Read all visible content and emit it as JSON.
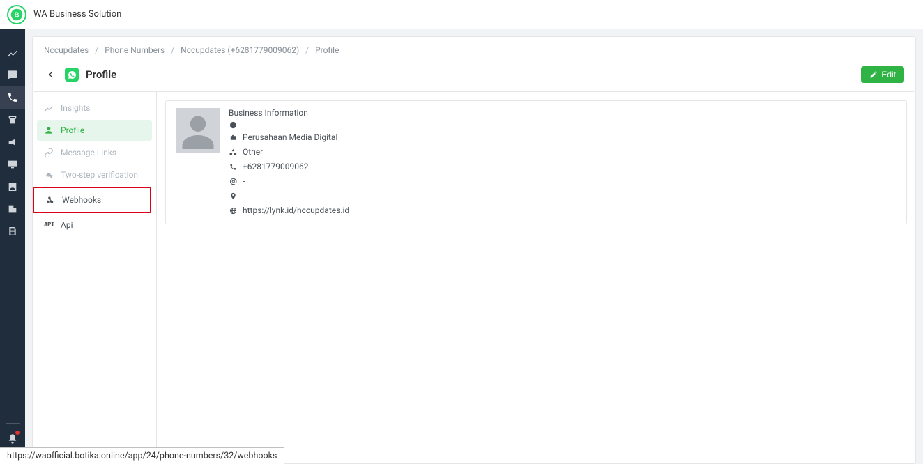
{
  "app": {
    "title": "WA Business Solution"
  },
  "breadcrumbs": {
    "items": [
      "Nccupdates",
      "Phone Numbers",
      "Nccupdates (+6281779009062)",
      "Profile"
    ]
  },
  "page": {
    "title": "Profile",
    "edit_label": "Edit"
  },
  "subnav": {
    "insights": "Insights",
    "profile": "Profile",
    "message_links": "Message Links",
    "two_step": "Two-step verification",
    "webhooks": "Webhooks",
    "api": "Api"
  },
  "business": {
    "heading": "Business Information",
    "company": "Perusahaan Media Digital",
    "category": "Other",
    "phone": "+6281779009062",
    "email": "-",
    "address": "-",
    "website": "https://lynk.id/nccupdates.id"
  },
  "status_url": "https://waofficial.botika.online/app/24/phone-numbers/32/webhooks"
}
